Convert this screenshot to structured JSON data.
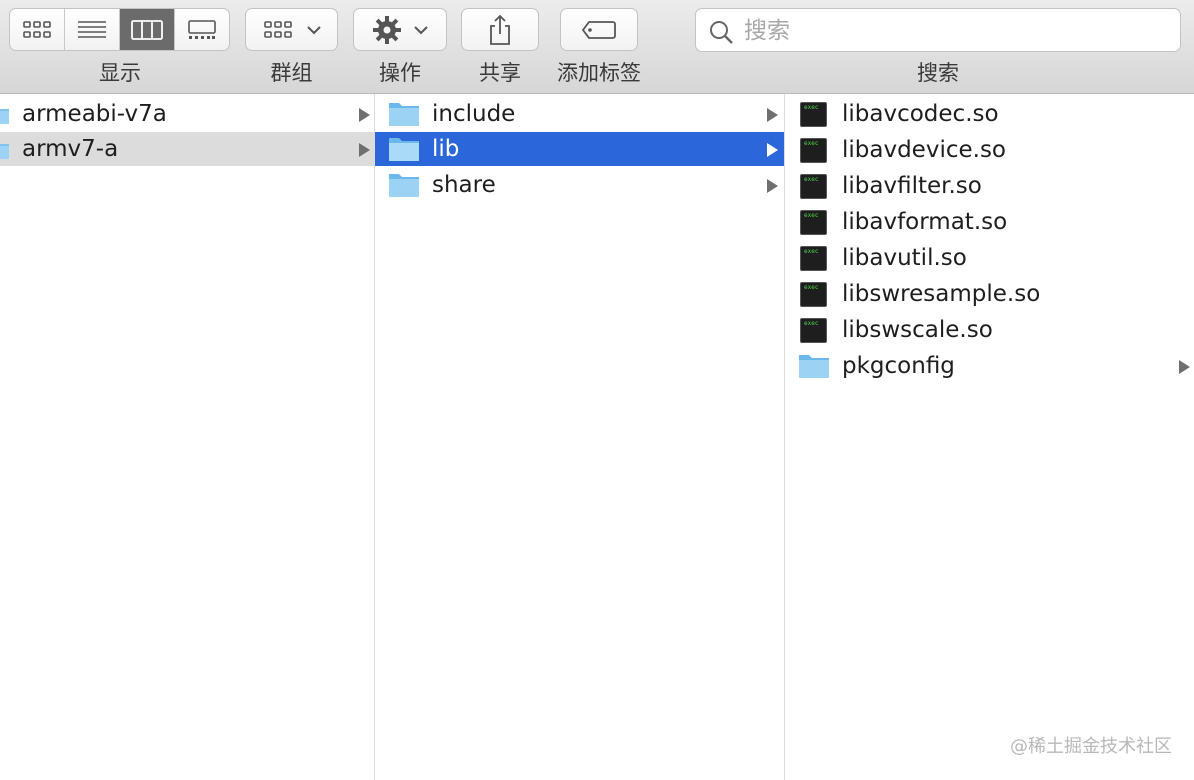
{
  "toolbar": {
    "view_label": "显示",
    "group_label": "群组",
    "action_label": "操作",
    "share_label": "共享",
    "tags_label": "添加标签",
    "search_label": "搜索",
    "search_placeholder": "搜索",
    "active_view": "columns"
  },
  "columns": [
    {
      "items": [
        {
          "name": "armeabi-v7a",
          "type": "folder",
          "has_children": true,
          "state": "normal"
        },
        {
          "name": "armv7-a",
          "type": "folder",
          "has_children": true,
          "state": "selected-inactive"
        }
      ]
    },
    {
      "items": [
        {
          "name": "include",
          "type": "folder",
          "has_children": true,
          "state": "normal"
        },
        {
          "name": "lib",
          "type": "folder",
          "has_children": true,
          "state": "selected-active"
        },
        {
          "name": "share",
          "type": "folder",
          "has_children": true,
          "state": "normal"
        }
      ]
    },
    {
      "items": [
        {
          "name": "libavcodec.so",
          "type": "exec",
          "has_children": false,
          "state": "normal"
        },
        {
          "name": "libavdevice.so",
          "type": "exec",
          "has_children": false,
          "state": "normal"
        },
        {
          "name": "libavfilter.so",
          "type": "exec",
          "has_children": false,
          "state": "normal"
        },
        {
          "name": "libavformat.so",
          "type": "exec",
          "has_children": false,
          "state": "normal"
        },
        {
          "name": "libavutil.so",
          "type": "exec",
          "has_children": false,
          "state": "normal"
        },
        {
          "name": "libswresample.so",
          "type": "exec",
          "has_children": false,
          "state": "normal"
        },
        {
          "name": "libswscale.so",
          "type": "exec",
          "has_children": false,
          "state": "normal"
        },
        {
          "name": "pkgconfig",
          "type": "folder",
          "has_children": true,
          "state": "normal"
        }
      ]
    }
  ],
  "exec_icon_text": "exec",
  "watermark": "@稀土掘金技术社区",
  "colors": {
    "selection_active": "#2b67d8",
    "selection_inactive": "#dcdcdc",
    "folder": "#7ec4f0"
  }
}
